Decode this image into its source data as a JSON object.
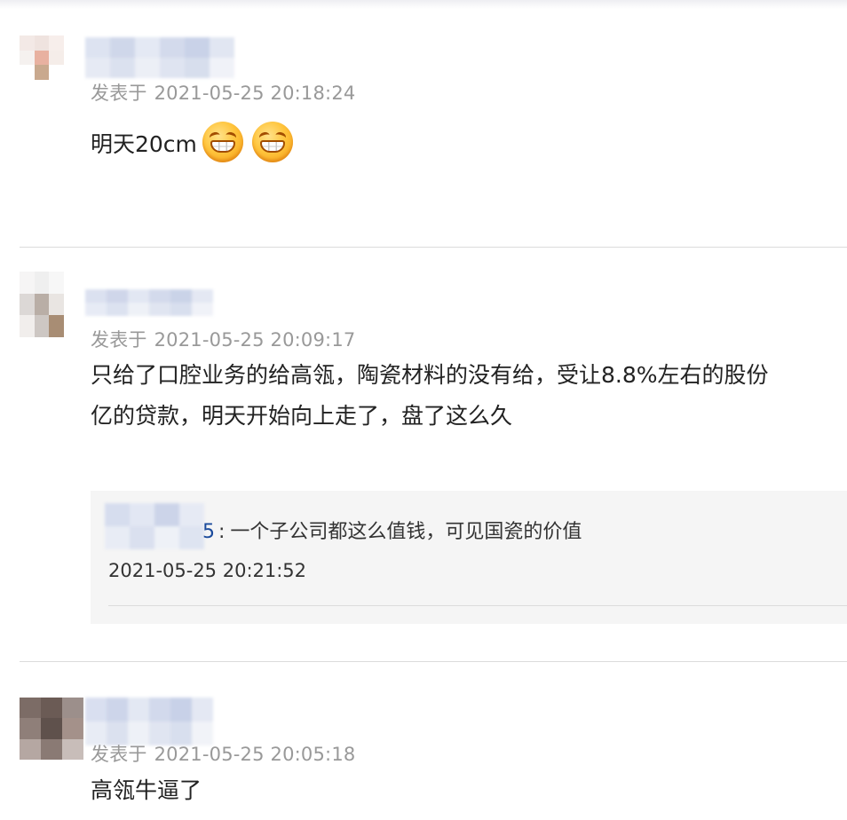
{
  "comments": [
    {
      "user_suffix": "",
      "meta_label": "发表于",
      "time": "2021-05-25 20:18:24",
      "content": "明天20cm",
      "emojis": [
        "grin-icon",
        "grin-icon"
      ]
    },
    {
      "meta_label": "发表于",
      "time": "2021-05-25 20:09:17",
      "content_lines": [
        "只给了口腔业务的给高瓴，陶瓷材料的没有给，受让8.8%左右的股份",
        "亿的贷款，明天开始向上走了，盘了这么久"
      ],
      "reply": {
        "user_visible": "5",
        "separator": ":",
        "text": "一个子公司都这么值钱，可见国瓷的价值",
        "time": "2021-05-25 20:21:52"
      }
    },
    {
      "meta_label": "发表于",
      "time": "2021-05-25 20:05:18",
      "content": "高瓴牛逼了"
    }
  ],
  "colors": {
    "meta_gray": "#999999",
    "reply_user_blue": "#1a4a9c",
    "reply_bg": "#f5f5f5",
    "divider": "#dcdcdc"
  }
}
